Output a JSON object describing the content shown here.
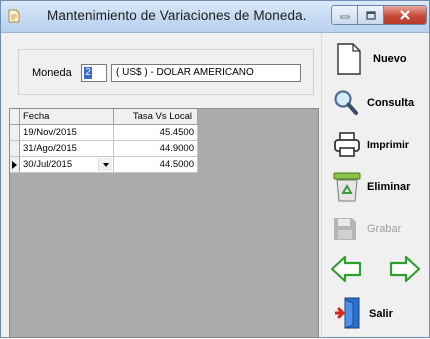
{
  "window": {
    "title": "Mantenimiento de Variaciones de Moneda.",
    "accent_title_gradient": "#c7dcf3",
    "close_color": "#c74b3a"
  },
  "moneda": {
    "label": "Moneda",
    "code": "2",
    "description": "( US$ ) - DOLAR AMERICANO"
  },
  "grid": {
    "columns": [
      "Fecha",
      "Tasa Vs Local"
    ],
    "rows": [
      {
        "fecha": "19/Nov/2015",
        "tasa": "45.4500"
      },
      {
        "fecha": "31/Ago/2015",
        "tasa": "44.9000"
      },
      {
        "fecha": "30/Jul/2015",
        "tasa": "44.5000"
      }
    ]
  },
  "buttons": {
    "nuevo": "Nuevo",
    "consulta": "Consulta",
    "imprimir": "Imprimir",
    "eliminar": "Eliminar",
    "grabar": "Grabar",
    "salir": "Salir"
  },
  "icons": {
    "app": "app-icon",
    "nuevo": "new-document-icon",
    "consulta": "magnifier-icon",
    "imprimir": "printer-icon",
    "eliminar": "recycle-bin-icon",
    "grabar": "floppy-disk-icon",
    "prev": "arrow-left-icon",
    "next": "arrow-right-icon",
    "salir": "exit-door-icon"
  }
}
